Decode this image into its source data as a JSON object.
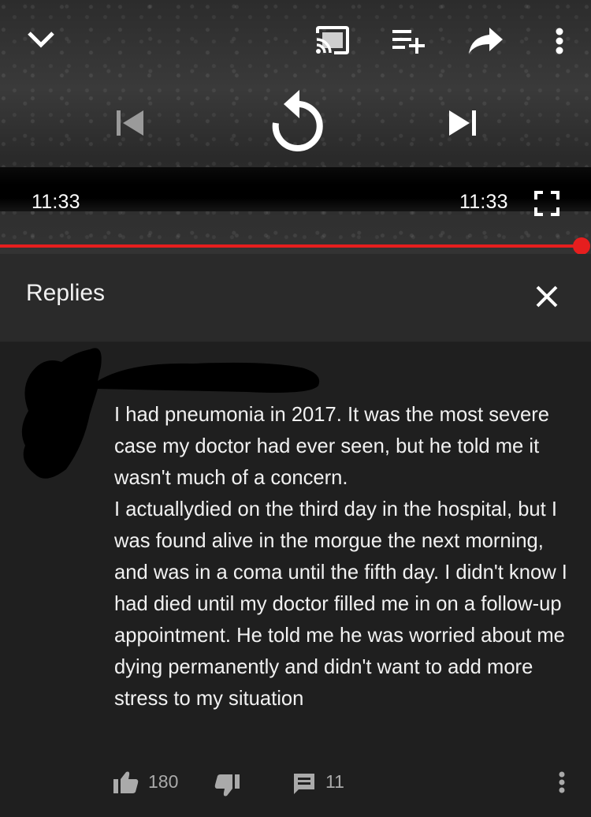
{
  "player": {
    "elapsed": "11:33",
    "duration": "11:33",
    "progress_fraction": 1.0,
    "accent_color": "#e61e1e",
    "icons": {
      "minimize": "chevron-down-icon",
      "cast": "cast-icon",
      "add_to_queue": "playlist-add-icon",
      "share": "share-icon",
      "more": "more-vert-icon",
      "previous": "skip-previous-icon",
      "replay": "replay-icon",
      "next": "skip-next-icon",
      "fullscreen": "fullscreen-icon"
    }
  },
  "replies_panel": {
    "title": "Replies",
    "close_icon": "close-icon"
  },
  "comment": {
    "paragraphs": [
      "I had pneumonia in 2017. It was the most severe case my doctor had ever seen, but he told me it wasn't much of a concern.",
      "I actuallydied on the third day in the hospital, but I was found alive in the morgue the next morning, and was in a coma until the fifth day. I didn't know I had died until my doctor filled me in on a follow-up appointment. He told me he was worried about me dying permanently and didn't want to add more stress to my situation"
    ],
    "likes": "180",
    "replies": "11",
    "icons": {
      "like": "thumbs-up-icon",
      "dislike": "thumbs-down-icon",
      "reply": "comment-icon",
      "menu": "more-vert-icon"
    }
  }
}
